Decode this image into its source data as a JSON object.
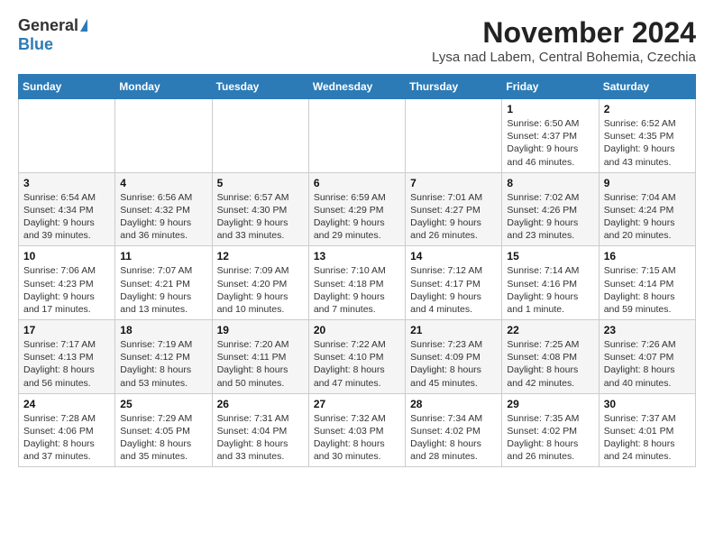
{
  "logo": {
    "general": "General",
    "blue": "Blue"
  },
  "title": "November 2024",
  "subtitle": "Lysa nad Labem, Central Bohemia, Czechia",
  "weekdays": [
    "Sunday",
    "Monday",
    "Tuesday",
    "Wednesday",
    "Thursday",
    "Friday",
    "Saturday"
  ],
  "weeks": [
    [
      {
        "day": "",
        "info": ""
      },
      {
        "day": "",
        "info": ""
      },
      {
        "day": "",
        "info": ""
      },
      {
        "day": "",
        "info": ""
      },
      {
        "day": "",
        "info": ""
      },
      {
        "day": "1",
        "info": "Sunrise: 6:50 AM\nSunset: 4:37 PM\nDaylight: 9 hours\nand 46 minutes."
      },
      {
        "day": "2",
        "info": "Sunrise: 6:52 AM\nSunset: 4:35 PM\nDaylight: 9 hours\nand 43 minutes."
      }
    ],
    [
      {
        "day": "3",
        "info": "Sunrise: 6:54 AM\nSunset: 4:34 PM\nDaylight: 9 hours\nand 39 minutes."
      },
      {
        "day": "4",
        "info": "Sunrise: 6:56 AM\nSunset: 4:32 PM\nDaylight: 9 hours\nand 36 minutes."
      },
      {
        "day": "5",
        "info": "Sunrise: 6:57 AM\nSunset: 4:30 PM\nDaylight: 9 hours\nand 33 minutes."
      },
      {
        "day": "6",
        "info": "Sunrise: 6:59 AM\nSunset: 4:29 PM\nDaylight: 9 hours\nand 29 minutes."
      },
      {
        "day": "7",
        "info": "Sunrise: 7:01 AM\nSunset: 4:27 PM\nDaylight: 9 hours\nand 26 minutes."
      },
      {
        "day": "8",
        "info": "Sunrise: 7:02 AM\nSunset: 4:26 PM\nDaylight: 9 hours\nand 23 minutes."
      },
      {
        "day": "9",
        "info": "Sunrise: 7:04 AM\nSunset: 4:24 PM\nDaylight: 9 hours\nand 20 minutes."
      }
    ],
    [
      {
        "day": "10",
        "info": "Sunrise: 7:06 AM\nSunset: 4:23 PM\nDaylight: 9 hours\nand 17 minutes."
      },
      {
        "day": "11",
        "info": "Sunrise: 7:07 AM\nSunset: 4:21 PM\nDaylight: 9 hours\nand 13 minutes."
      },
      {
        "day": "12",
        "info": "Sunrise: 7:09 AM\nSunset: 4:20 PM\nDaylight: 9 hours\nand 10 minutes."
      },
      {
        "day": "13",
        "info": "Sunrise: 7:10 AM\nSunset: 4:18 PM\nDaylight: 9 hours\nand 7 minutes."
      },
      {
        "day": "14",
        "info": "Sunrise: 7:12 AM\nSunset: 4:17 PM\nDaylight: 9 hours\nand 4 minutes."
      },
      {
        "day": "15",
        "info": "Sunrise: 7:14 AM\nSunset: 4:16 PM\nDaylight: 9 hours\nand 1 minute."
      },
      {
        "day": "16",
        "info": "Sunrise: 7:15 AM\nSunset: 4:14 PM\nDaylight: 8 hours\nand 59 minutes."
      }
    ],
    [
      {
        "day": "17",
        "info": "Sunrise: 7:17 AM\nSunset: 4:13 PM\nDaylight: 8 hours\nand 56 minutes."
      },
      {
        "day": "18",
        "info": "Sunrise: 7:19 AM\nSunset: 4:12 PM\nDaylight: 8 hours\nand 53 minutes."
      },
      {
        "day": "19",
        "info": "Sunrise: 7:20 AM\nSunset: 4:11 PM\nDaylight: 8 hours\nand 50 minutes."
      },
      {
        "day": "20",
        "info": "Sunrise: 7:22 AM\nSunset: 4:10 PM\nDaylight: 8 hours\nand 47 minutes."
      },
      {
        "day": "21",
        "info": "Sunrise: 7:23 AM\nSunset: 4:09 PM\nDaylight: 8 hours\nand 45 minutes."
      },
      {
        "day": "22",
        "info": "Sunrise: 7:25 AM\nSunset: 4:08 PM\nDaylight: 8 hours\nand 42 minutes."
      },
      {
        "day": "23",
        "info": "Sunrise: 7:26 AM\nSunset: 4:07 PM\nDaylight: 8 hours\nand 40 minutes."
      }
    ],
    [
      {
        "day": "24",
        "info": "Sunrise: 7:28 AM\nSunset: 4:06 PM\nDaylight: 8 hours\nand 37 minutes."
      },
      {
        "day": "25",
        "info": "Sunrise: 7:29 AM\nSunset: 4:05 PM\nDaylight: 8 hours\nand 35 minutes."
      },
      {
        "day": "26",
        "info": "Sunrise: 7:31 AM\nSunset: 4:04 PM\nDaylight: 8 hours\nand 33 minutes."
      },
      {
        "day": "27",
        "info": "Sunrise: 7:32 AM\nSunset: 4:03 PM\nDaylight: 8 hours\nand 30 minutes."
      },
      {
        "day": "28",
        "info": "Sunrise: 7:34 AM\nSunset: 4:02 PM\nDaylight: 8 hours\nand 28 minutes."
      },
      {
        "day": "29",
        "info": "Sunrise: 7:35 AM\nSunset: 4:02 PM\nDaylight: 8 hours\nand 26 minutes."
      },
      {
        "day": "30",
        "info": "Sunrise: 7:37 AM\nSunset: 4:01 PM\nDaylight: 8 hours\nand 24 minutes."
      }
    ]
  ]
}
